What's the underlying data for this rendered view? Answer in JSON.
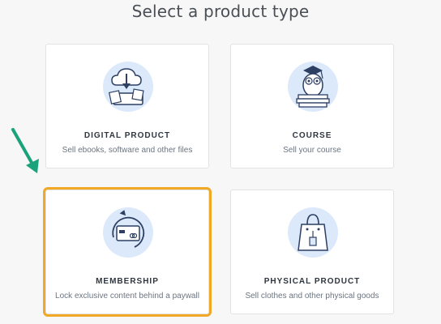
{
  "page": {
    "title": "Select a product type"
  },
  "colors": {
    "highlight": "#f0a826",
    "arrow": "#1aa37a",
    "icon_bg": "#dbe9fb",
    "icon_stroke": "#2d3f63"
  },
  "cards": [
    {
      "id": "digital",
      "title": "DIGITAL PRODUCT",
      "description": "Sell ebooks, software and other files",
      "icon": "cloud-download-icon",
      "selected": false
    },
    {
      "id": "course",
      "title": "COURSE",
      "description": "Sell your course",
      "icon": "owl-books-icon",
      "selected": false
    },
    {
      "id": "membership",
      "title": "MEMBERSHIP",
      "description": "Lock exclusive content behind a paywall",
      "icon": "card-cycle-icon",
      "selected": true
    },
    {
      "id": "physical",
      "title": "PHYSICAL PRODUCT",
      "description": "Sell clothes and other physical goods",
      "icon": "shopping-bag-icon",
      "selected": false
    }
  ]
}
